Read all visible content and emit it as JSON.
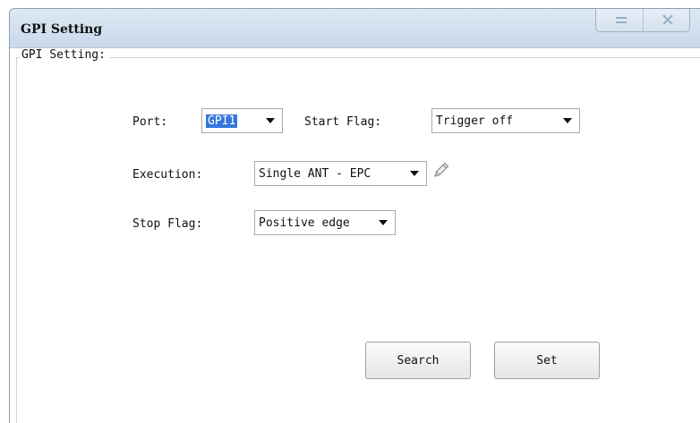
{
  "window": {
    "title": "GPI Setting"
  },
  "group": {
    "label": "GPI Setting:"
  },
  "form": {
    "port": {
      "label": "Port:",
      "value": "GPI1"
    },
    "start_flag": {
      "label": "Start Flag:",
      "value": "Trigger off"
    },
    "execution": {
      "label": "Execution:",
      "value": "Single ANT - EPC"
    },
    "stop_flag": {
      "label": "Stop Flag:",
      "value": "Positive edge"
    }
  },
  "buttons": {
    "search": "Search",
    "set": "Set"
  },
  "icons": {
    "edit": "pencil-icon",
    "minimize": "minimize-icon",
    "close": "close-icon"
  }
}
